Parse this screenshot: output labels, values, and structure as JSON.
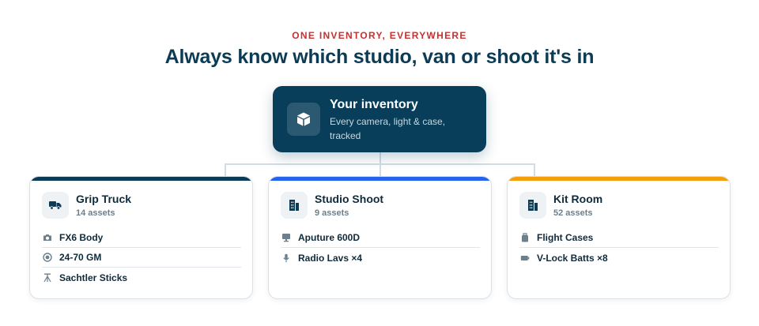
{
  "header": {
    "eyebrow": "ONE INVENTORY, EVERYWHERE",
    "headline": "Always know which studio, van or shoot it's in"
  },
  "root": {
    "title": "Your inventory",
    "subtitle": "Every camera, light & case, tracked",
    "icon": "box-icon"
  },
  "colors": {
    "root_bg": "#083e5a",
    "eyebrow": "#c53030",
    "grip_accent": "#0b3b55",
    "studio_accent": "#2563eb",
    "kit_accent": "#f59e0b"
  },
  "locations": [
    {
      "name": "Grip Truck",
      "count": "14 assets",
      "icon": "truck-icon",
      "accent": "#0b3b55",
      "items": [
        {
          "label": "FX6 Body",
          "icon": "camera-icon"
        },
        {
          "label": "24-70 GM",
          "icon": "lens-icon"
        },
        {
          "label": "Sachtler Sticks",
          "icon": "tripod-icon"
        }
      ]
    },
    {
      "name": "Studio Shoot",
      "count": "9 assets",
      "icon": "building-icon",
      "accent": "#2563eb",
      "items": [
        {
          "label": "Aputure 600D",
          "icon": "monitor-icon"
        },
        {
          "label": "Radio Lavs ×4",
          "icon": "mic-icon"
        }
      ]
    },
    {
      "name": "Kit Room",
      "count": "52 assets",
      "icon": "building-icon",
      "accent": "#f59e0b",
      "items": [
        {
          "label": "Flight Cases",
          "icon": "case-icon"
        },
        {
          "label": "V-Lock Batts ×8",
          "icon": "battery-icon"
        }
      ]
    }
  ]
}
